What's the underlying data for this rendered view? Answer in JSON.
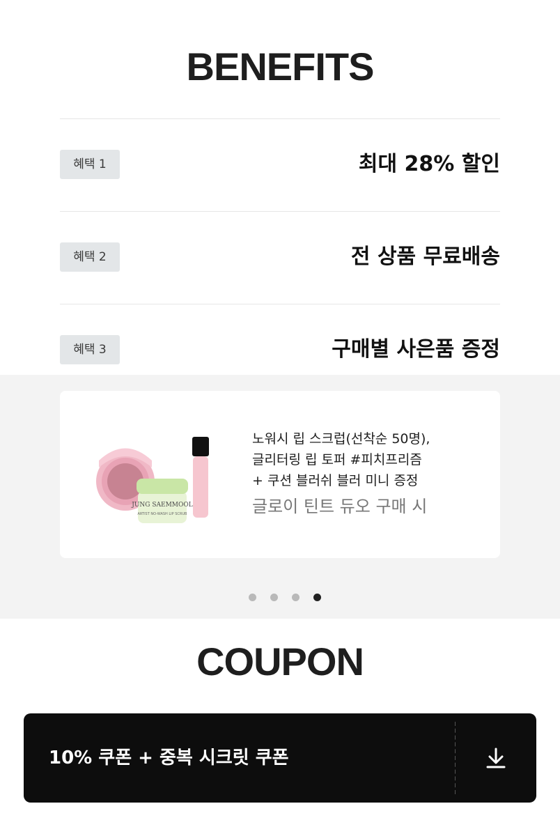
{
  "benefits": {
    "title": "BENEFITS",
    "items": [
      {
        "badge": "혜택 1",
        "text": "최대 28% 할인"
      },
      {
        "badge": "혜택 2",
        "text": "전 상품 무료배송"
      },
      {
        "badge": "혜택 3",
        "text": "구매별 사은품 증정"
      }
    ]
  },
  "gift_card": {
    "description": "노워시 립 스크럽(선착순 50명),\n글리터링 립 토퍼 #피치프리즘\n+ 쿠션 블러쉬 블러 미니 증정",
    "condition": "글로이 틴트 듀오 구매 시",
    "product_brand": "JUNG SAEMMOOL",
    "product_name": "ARTIST NO-WASH LIP SCRUB"
  },
  "carousel": {
    "total": 4,
    "active_index": 3
  },
  "coupon": {
    "title": "COUPON",
    "label": "10% 쿠폰 + 중복 시크릿 쿠폰",
    "action_icon": "download-icon"
  },
  "colors": {
    "badge_bg": "#e3e6e8",
    "band_bg": "#f3f3f3",
    "coupon_bg": "#0d0d0d",
    "dot_active": "#222222",
    "dot_inactive": "#b9b9b9"
  }
}
